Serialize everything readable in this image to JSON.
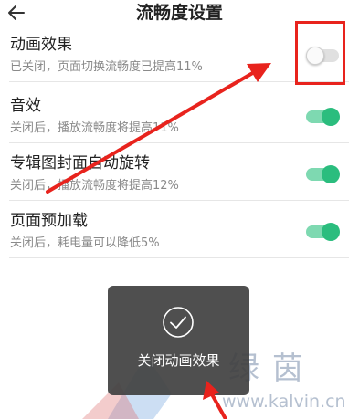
{
  "header": {
    "title": "流畅度设置",
    "back_icon": "arrow-left-icon"
  },
  "settings": [
    {
      "title": "动画效果",
      "subtitle": "已关闭，页面切换流畅度已提高11%",
      "enabled": false
    },
    {
      "title": "音效",
      "subtitle": "关闭后，播放流畅度将提高11%",
      "enabled": true
    },
    {
      "title": "专辑图封面自动旋转",
      "subtitle": "关闭后，播放流畅度将提高12%",
      "enabled": true
    },
    {
      "title": "页面预加载",
      "subtitle": "关闭后，耗电量可以降低5%",
      "enabled": true
    }
  ],
  "toast": {
    "icon": "check-circle-icon",
    "message": "关闭动画效果"
  },
  "watermark": {
    "text": "绿茵",
    "url": "www.kalvin.cn"
  },
  "colors": {
    "toggle_on": "#2bbd7e",
    "toggle_on_track": "#7ed9b1",
    "annotation_red": "#e8231d",
    "toast_bg": "#404040"
  }
}
